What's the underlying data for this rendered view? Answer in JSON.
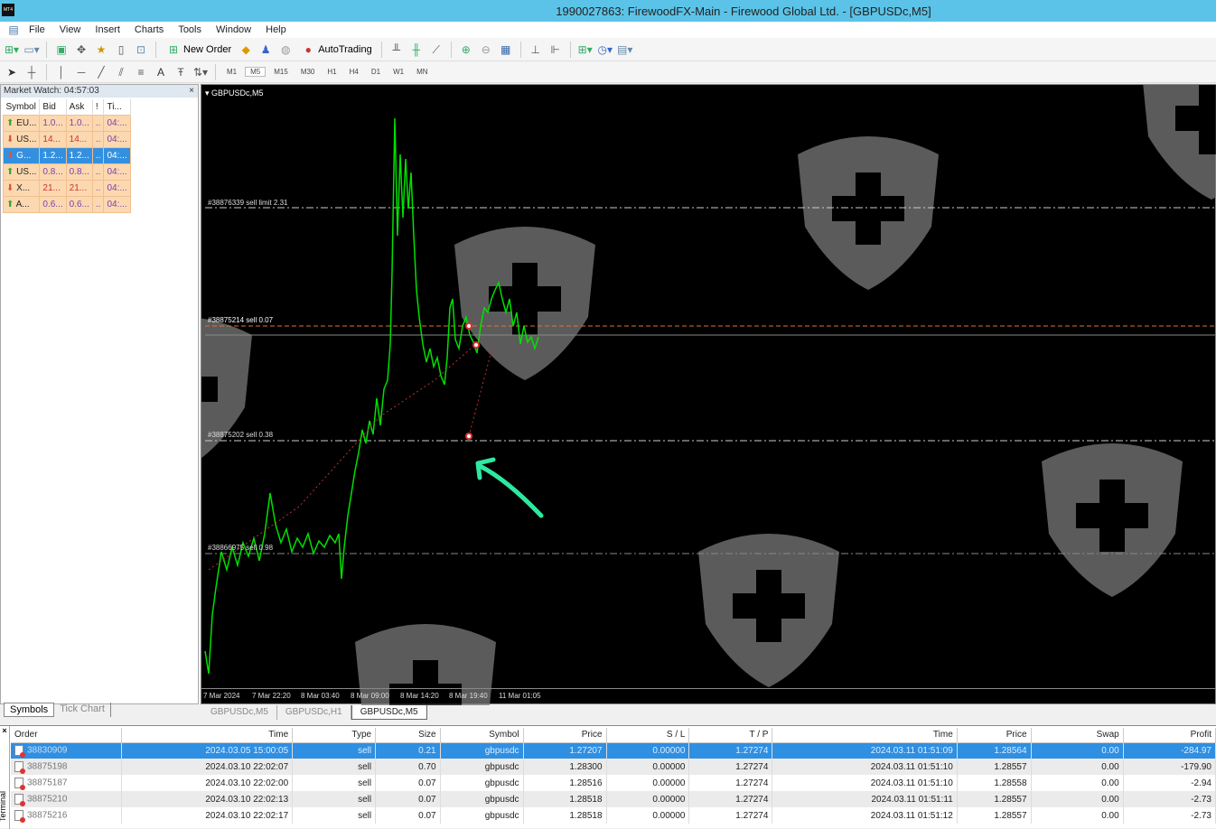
{
  "window": {
    "title": "1990027863: FirewoodFX-Main - Firewood Global Ltd. - [GBPUSDc,M5]",
    "logo_text": "MT4"
  },
  "menu": [
    "File",
    "View",
    "Insert",
    "Charts",
    "Tools",
    "Window",
    "Help"
  ],
  "toolbar": {
    "new_order": "New Order",
    "autotrading": "AutoTrading",
    "timeframes": [
      "M1",
      "M5",
      "M15",
      "M30",
      "H1",
      "H4",
      "D1",
      "W1",
      "MN"
    ],
    "text_tool": "A"
  },
  "market_watch": {
    "title": "Market Watch: 04:57:03",
    "close": "×",
    "columns": [
      "Symbol",
      "Bid",
      "Ask",
      "!",
      "Ti..."
    ],
    "rows": [
      {
        "symbol": "EU...",
        "bid": "1.0...",
        "ask": "1.0...",
        "spread": "..",
        "time": "04:...",
        "dir": "up"
      },
      {
        "symbol": "US...",
        "bid": "14...",
        "ask": "14...",
        "spread": "..",
        "time": "04:...",
        "dir": "down"
      },
      {
        "symbol": "G...",
        "bid": "1.2...",
        "ask": "1.2...",
        "spread": "..",
        "time": "04:...",
        "dir": "down",
        "selected": true
      },
      {
        "symbol": "US...",
        "bid": "0.8...",
        "ask": "0.8...",
        "spread": "..",
        "time": "04:...",
        "dir": "up"
      },
      {
        "symbol": "X...",
        "bid": "21...",
        "ask": "21...",
        "spread": "..",
        "time": "04:...",
        "dir": "down"
      },
      {
        "symbol": "A...",
        "bid": "0.6...",
        "ask": "0.6...",
        "spread": "..",
        "time": "04:...",
        "dir": "up"
      }
    ],
    "tabs": [
      "Symbols",
      "Tick Chart"
    ]
  },
  "chart": {
    "symbol_label": "GBPUSDc,M5",
    "order_lines": [
      "#38876339 sell limit 2.31",
      "#38875214 sell 0.07",
      "#38875202 sell 0.38",
      "#38866975 sell 0.98"
    ],
    "time_axis": [
      "7 Mar 2024",
      "7 Mar 22:20",
      "8 Mar 03:40",
      "8 Mar 09:00",
      "8 Mar 14:20",
      "8 Mar 19:40",
      "11 Mar 01:05"
    ],
    "tabs": [
      "GBPUSDc,M5",
      "GBPUSDc,H1",
      "GBPUSDc,M5"
    ],
    "colors": {
      "price": "#00e000",
      "sell_line": "#e07030",
      "annotation_arrow": "#2ee8a0"
    }
  },
  "terminal": {
    "side_label": "Terminal",
    "columns": [
      "Order",
      "Time",
      "Type",
      "Size",
      "Symbol",
      "Price",
      "S / L",
      "T / P",
      "Time",
      "Price",
      "Swap",
      "Profit"
    ],
    "rows": [
      [
        "38830909",
        "2024.03.05 15:00:05",
        "sell",
        "0.21",
        "gbpusdc",
        "1.27207",
        "0.00000",
        "1.27274",
        "2024.03.11 01:51:09",
        "1.28564",
        "0.00",
        "-284.97"
      ],
      [
        "38875198",
        "2024.03.10 22:02:07",
        "sell",
        "0.70",
        "gbpusdc",
        "1.28300",
        "0.00000",
        "1.27274",
        "2024.03.11 01:51:10",
        "1.28557",
        "0.00",
        "-179.90"
      ],
      [
        "38875187",
        "2024.03.10 22:02:00",
        "sell",
        "0.07",
        "gbpusdc",
        "1.28516",
        "0.00000",
        "1.27274",
        "2024.03.11 01:51:10",
        "1.28558",
        "0.00",
        "-2.94"
      ],
      [
        "38875210",
        "2024.03.10 22:02:13",
        "sell",
        "0.07",
        "gbpusdc",
        "1.28518",
        "0.00000",
        "1.27274",
        "2024.03.11 01:51:11",
        "1.28557",
        "0.00",
        "-2.73"
      ],
      [
        "38875216",
        "2024.03.10 22:02:17",
        "sell",
        "0.07",
        "gbpusdc",
        "1.28518",
        "0.00000",
        "1.27274",
        "2024.03.11 01:51:12",
        "1.28557",
        "0.00",
        "-2.73"
      ]
    ]
  }
}
